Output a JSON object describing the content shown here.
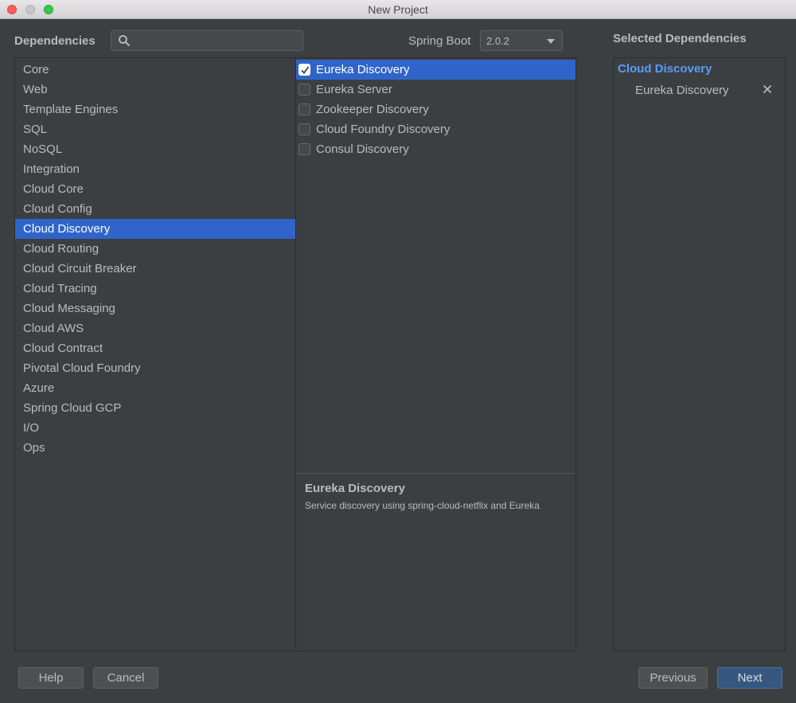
{
  "window": {
    "title": "New Project"
  },
  "header": {
    "dependencies_label": "Dependencies",
    "search_value": "",
    "spring_boot_label": "Spring Boot",
    "spring_boot_version": "2.0.2",
    "selected_title": "Selected Dependencies"
  },
  "categories": [
    {
      "label": "Core"
    },
    {
      "label": "Web"
    },
    {
      "label": "Template Engines"
    },
    {
      "label": "SQL"
    },
    {
      "label": "NoSQL"
    },
    {
      "label": "Integration"
    },
    {
      "label": "Cloud Core"
    },
    {
      "label": "Cloud Config"
    },
    {
      "label": "Cloud Discovery",
      "selected": true
    },
    {
      "label": "Cloud Routing"
    },
    {
      "label": "Cloud Circuit Breaker"
    },
    {
      "label": "Cloud Tracing"
    },
    {
      "label": "Cloud Messaging"
    },
    {
      "label": "Cloud AWS"
    },
    {
      "label": "Cloud Contract"
    },
    {
      "label": "Pivotal Cloud Foundry"
    },
    {
      "label": "Azure"
    },
    {
      "label": "Spring Cloud GCP"
    },
    {
      "label": "I/O"
    },
    {
      "label": "Ops"
    }
  ],
  "dependencies": [
    {
      "label": "Eureka Discovery",
      "checked": true,
      "selected": true
    },
    {
      "label": "Eureka Server",
      "checked": false
    },
    {
      "label": "Zookeeper Discovery",
      "checked": false
    },
    {
      "label": "Cloud Foundry Discovery",
      "checked": false
    },
    {
      "label": "Consul Discovery",
      "checked": false
    }
  ],
  "description": {
    "title": "Eureka Discovery",
    "text": "Service discovery using spring-cloud-netflix and Eureka"
  },
  "selected": {
    "group": "Cloud Discovery",
    "items": [
      {
        "label": "Eureka Discovery"
      }
    ]
  },
  "buttons": {
    "help": "Help",
    "cancel": "Cancel",
    "previous": "Previous",
    "next": "Next"
  },
  "colors": {
    "background": "#3c3f41",
    "selection": "#2f65ca",
    "accent_link": "#589df6",
    "default_button": "#365880"
  },
  "icons": {
    "search": "search-icon",
    "dropdown": "chevron-down-icon",
    "check": "check-icon",
    "remove": "close-icon"
  }
}
